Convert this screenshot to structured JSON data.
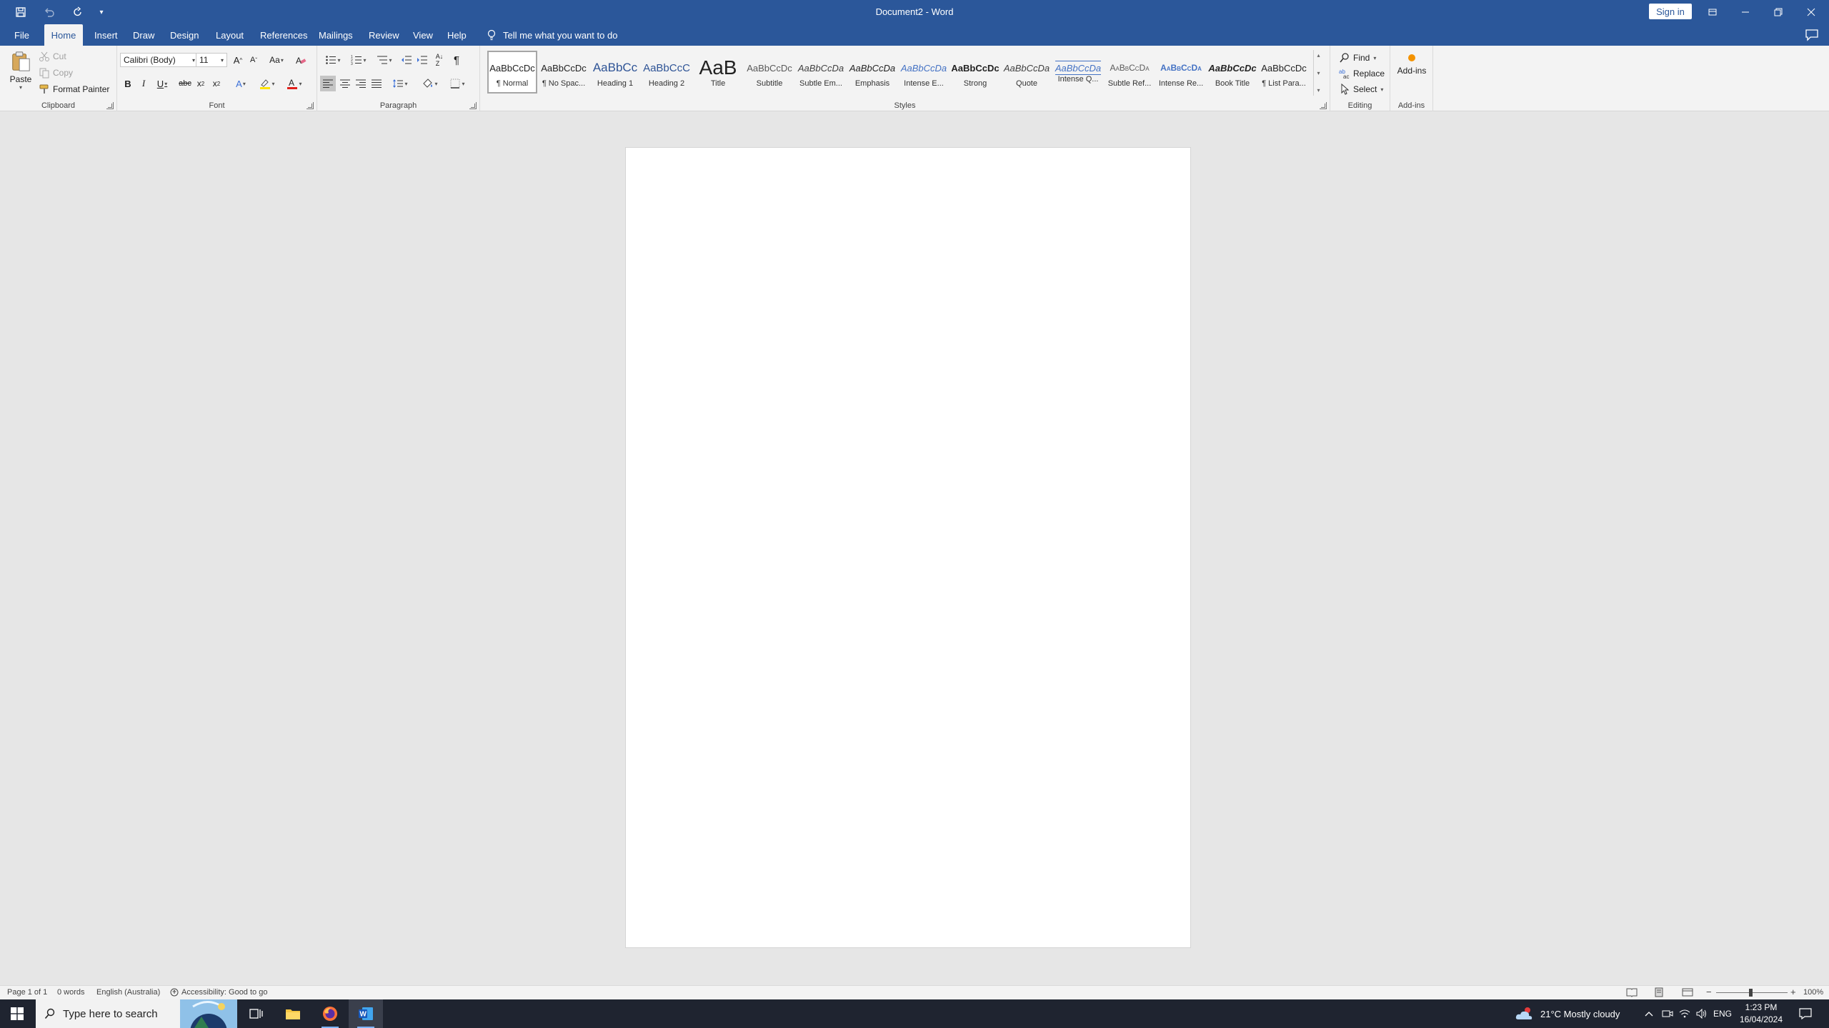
{
  "window": {
    "title": "Document2  -  Word",
    "sign_in": "Sign in"
  },
  "tabs": [
    "File",
    "Home",
    "Insert",
    "Draw",
    "Design",
    "Layout",
    "References",
    "Mailings",
    "Review",
    "View",
    "Help"
  ],
  "active_tab": "Home",
  "tell_me": "Tell me what you want to do",
  "clipboard": {
    "paste": "Paste",
    "cut": "Cut",
    "copy": "Copy",
    "format_painter": "Format Painter",
    "label": "Clipboard"
  },
  "font": {
    "name": "Calibri (Body)",
    "size": "11",
    "label": "Font"
  },
  "paragraph": {
    "label": "Paragraph"
  },
  "styles": {
    "label": "Styles",
    "items": [
      {
        "preview": "AaBbCcDc",
        "name": "¶ Normal"
      },
      {
        "preview": "AaBbCcDc",
        "name": "¶ No Spac..."
      },
      {
        "preview": "AaBbCc",
        "name": "Heading 1"
      },
      {
        "preview": "AaBbCcC",
        "name": "Heading 2"
      },
      {
        "preview": "AaB",
        "name": "Title"
      },
      {
        "preview": "AaBbCcDc",
        "name": "Subtitle"
      },
      {
        "preview": "AaBbCcDa",
        "name": "Subtle Em..."
      },
      {
        "preview": "AaBbCcDa",
        "name": "Emphasis"
      },
      {
        "preview": "AaBbCcDa",
        "name": "Intense E..."
      },
      {
        "preview": "AaBbCcDc",
        "name": "Strong"
      },
      {
        "preview": "AaBbCcDa",
        "name": "Quote"
      },
      {
        "preview": "AaBbCcDa",
        "name": "Intense Q..."
      },
      {
        "preview": "AaBbCcDa",
        "name": "Subtle Ref..."
      },
      {
        "preview": "AaBbCcDa",
        "name": "Intense Re..."
      },
      {
        "preview": "AaBbCcDc",
        "name": "Book Title"
      },
      {
        "preview": "AaBbCcDc",
        "name": "¶ List Para..."
      }
    ]
  },
  "editing": {
    "find": "Find",
    "replace": "Replace",
    "select": "Select",
    "label": "Editing"
  },
  "addins": {
    "button": "Add-ins",
    "label": "Add-ins"
  },
  "status": {
    "page": "Page 1 of 1",
    "words": "0 words",
    "language": "English (Australia)",
    "accessibility": "Accessibility: Good to go",
    "zoom": "100%"
  },
  "taskbar": {
    "search_placeholder": "Type here to search",
    "weather": "21°C  Mostly cloudy",
    "lang": "ENG",
    "time": "1:23 PM",
    "date": "16/04/2024"
  },
  "colors": {
    "accent": "#2b579a",
    "font_color": "#e0201b",
    "highlight": "#ffe400"
  }
}
